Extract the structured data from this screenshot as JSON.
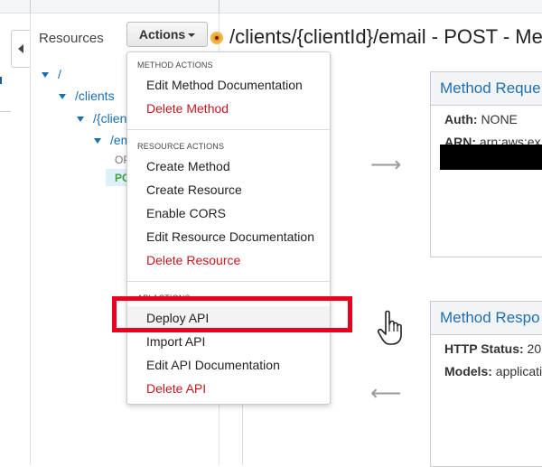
{
  "resources_panel": {
    "title": "Resources",
    "actions_label": "Actions",
    "tree": [
      {
        "label": "/"
      },
      {
        "label": "/clients"
      },
      {
        "label": "/{client"
      },
      {
        "label": "/em"
      }
    ],
    "methods": [
      {
        "label": "OP"
      },
      {
        "label": "PO"
      }
    ]
  },
  "header": {
    "title": "/clients/{clientId}/email - POST - Me"
  },
  "dropdown": {
    "method_actions_header": "METHOD ACTIONS",
    "edit_method_doc": "Edit Method Documentation",
    "delete_method": "Delete Method",
    "resource_actions_header": "RESOURCE ACTIONS",
    "create_method": "Create Method",
    "create_resource": "Create Resource",
    "enable_cors": "Enable CORS",
    "edit_resource_doc": "Edit Resource Documentation",
    "delete_resource": "Delete Resource",
    "api_actions_header": "API ACTIONS",
    "deploy_api": "Deploy API",
    "import_api": "Import API",
    "edit_api_doc": "Edit API Documentation",
    "delete_api": "Delete API"
  },
  "method_request": {
    "title": "Method Reque",
    "auth_label": "Auth:",
    "auth_value": "NONE",
    "arn_label": "ARN:",
    "arn_value": "arn:aws:ex"
  },
  "method_response": {
    "title": "Method Respo",
    "status_label": "HTTP Status:",
    "status_value": "20",
    "models_label": "Models:",
    "models_value": "applicati"
  },
  "colors": {
    "accent": "#1f6fb0",
    "danger": "#c7181f",
    "highlight": "#e8001c",
    "post_method": "#3fa33f"
  }
}
